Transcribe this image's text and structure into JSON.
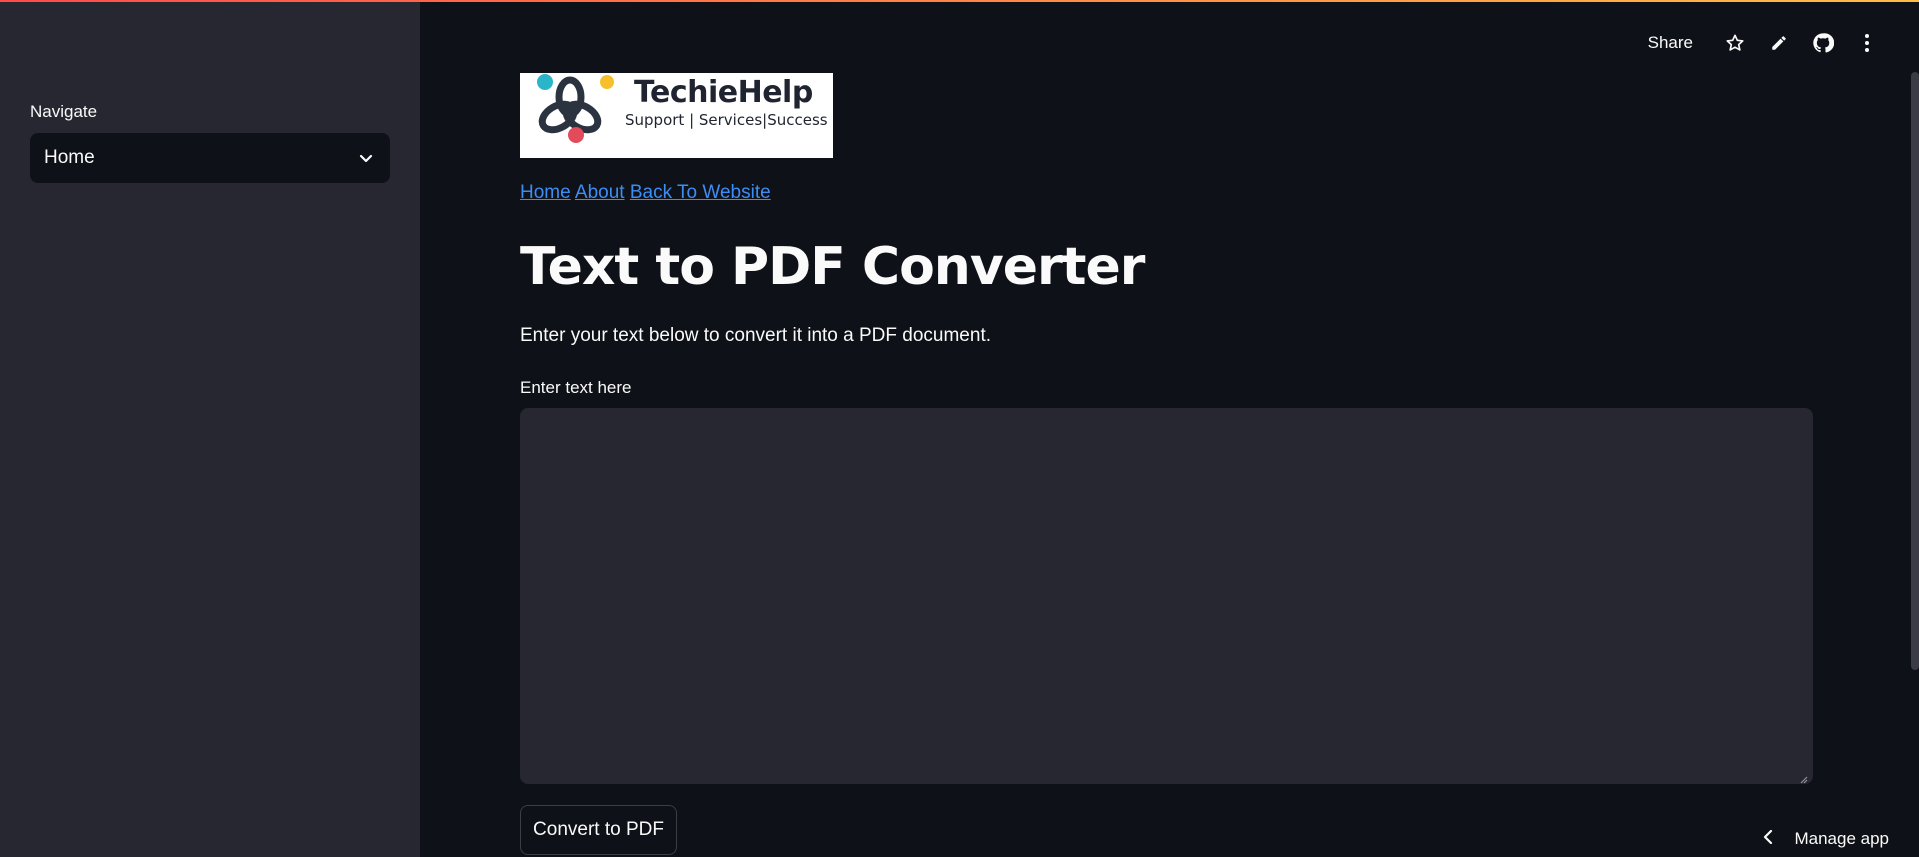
{
  "sidebar": {
    "navigate_label": "Navigate",
    "select_value": "Home"
  },
  "toolbar": {
    "share_label": "Share",
    "icons": [
      "star-icon",
      "pencil-icon",
      "github-icon",
      "more-vertical-icon"
    ]
  },
  "logo": {
    "name": "TechieHelp",
    "tagline": "Support | Services|Success"
  },
  "links": [
    {
      "label": "Home"
    },
    {
      "label": "About"
    },
    {
      "label": "Back To Website"
    }
  ],
  "main": {
    "title": "Text to PDF Converter",
    "description": "Enter your text below to convert it into a PDF document.",
    "textarea_label": "Enter text here",
    "textarea_value": "",
    "convert_button": "Convert to PDF"
  },
  "footer": {
    "manage_label": "Manage app"
  },
  "colors": {
    "background": "#0e1117",
    "sidebar": "#262730",
    "link": "#3d8df5",
    "text": "#fafafa"
  }
}
